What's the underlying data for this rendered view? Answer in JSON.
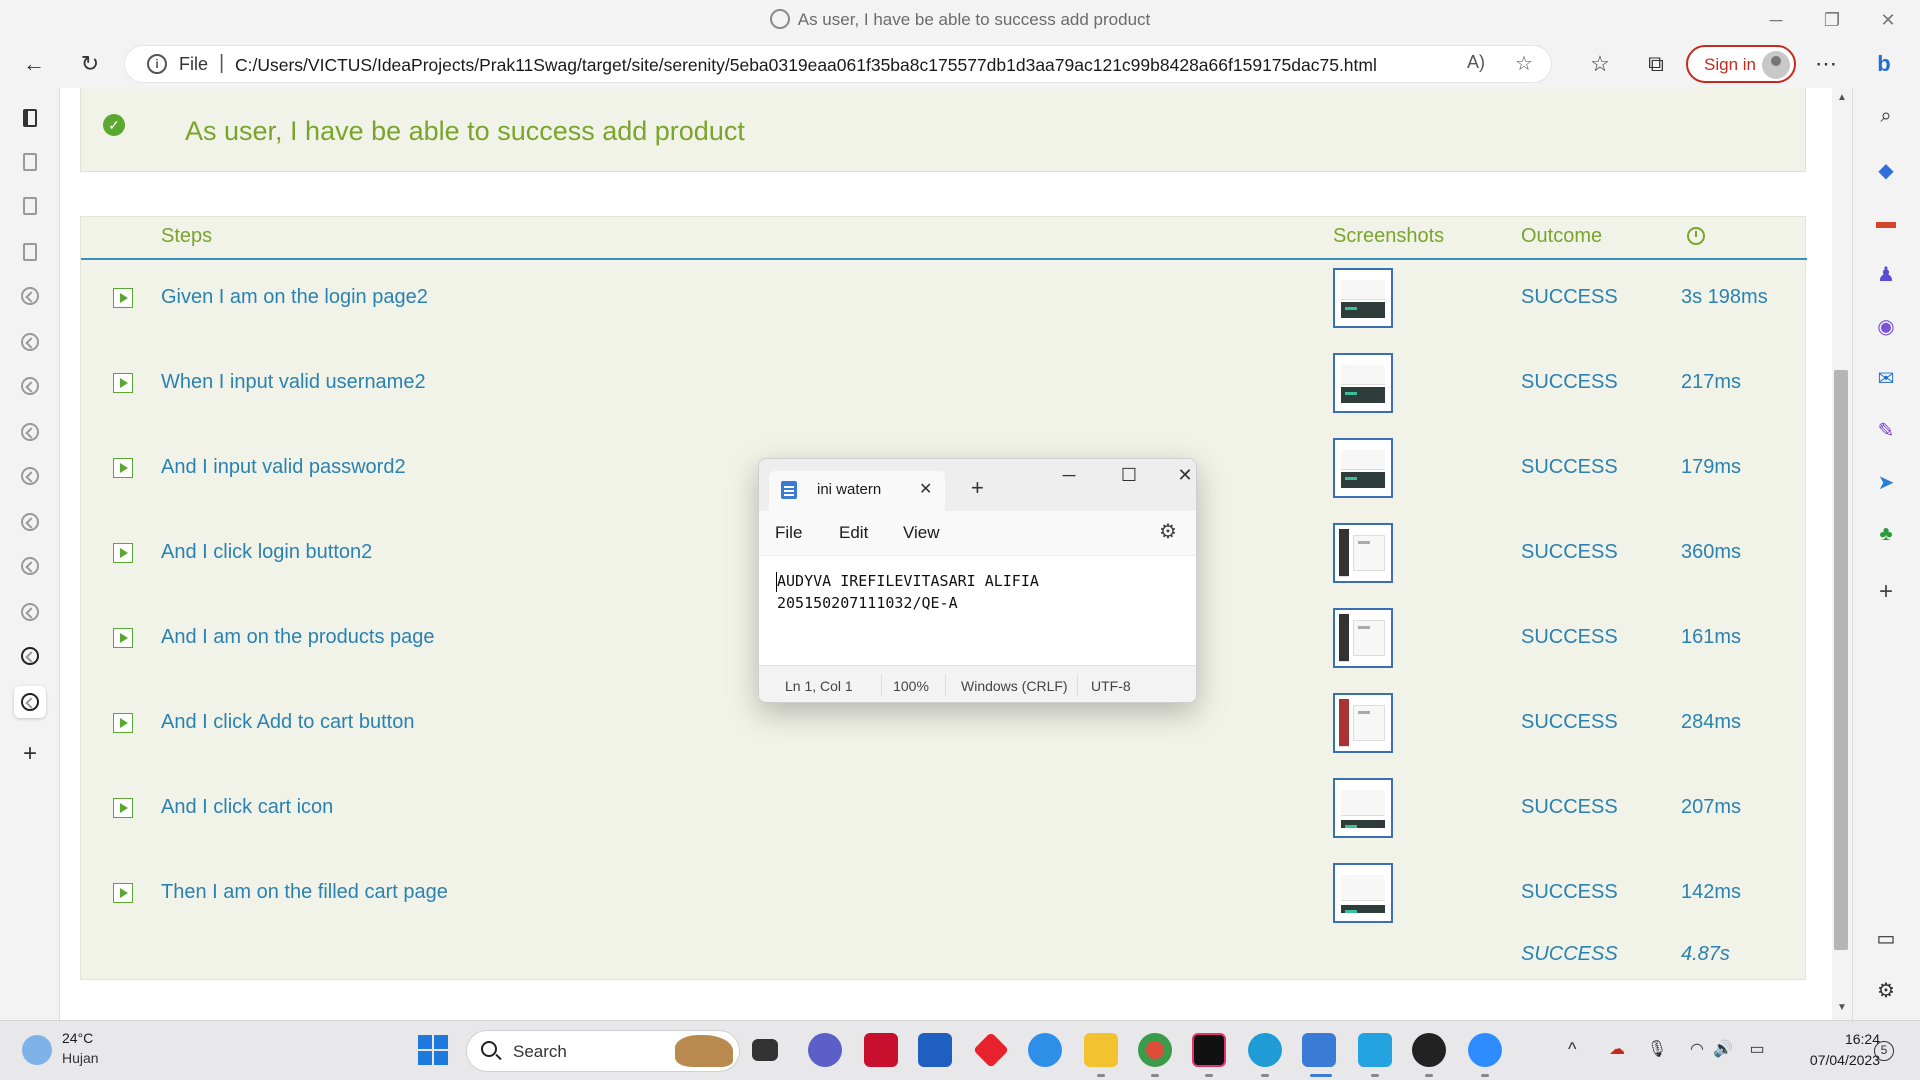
{
  "window": {
    "title": "As user, I have be able to success add product"
  },
  "address": {
    "scheme_label": "File",
    "url": "C:/Users/VICTUS/IdeaProjects/Prak11Swag/target/site/serenity/5eba0319eaa061f35ba8c175577db1d3aa79ac121c99b8428a66f159175dac75.html"
  },
  "signin": {
    "label": "Sign in"
  },
  "scenario": {
    "title": "As user, I have be able to success add product"
  },
  "table": {
    "headers": {
      "steps": "Steps",
      "screenshots": "Screenshots",
      "outcome": "Outcome"
    },
    "rows": [
      {
        "step": "Given I am on the login page2",
        "outcome": "SUCCESS",
        "duration": "3s 198ms"
      },
      {
        "step": "When I input valid username2",
        "outcome": "SUCCESS",
        "duration": "217ms"
      },
      {
        "step": "And I input valid password2",
        "outcome": "SUCCESS",
        "duration": "179ms"
      },
      {
        "step": "And I click login button2",
        "outcome": "SUCCESS",
        "duration": "360ms"
      },
      {
        "step": "And I am on the products page",
        "outcome": "SUCCESS",
        "duration": "161ms"
      },
      {
        "step": "And I click Add to cart button",
        "outcome": "SUCCESS",
        "duration": "284ms"
      },
      {
        "step": "And I click cart icon",
        "outcome": "SUCCESS",
        "duration": "207ms"
      },
      {
        "step": "Then I am on the filled cart page",
        "outcome": "SUCCESS",
        "duration": "142ms"
      }
    ],
    "total": {
      "outcome": "SUCCESS",
      "duration": "4.87s"
    }
  },
  "notepad": {
    "tab_title": "ini watern",
    "menu": {
      "file": "File",
      "edit": "Edit",
      "view": "View"
    },
    "content": [
      "AUDYVA IREFILEVITASARI ALIFIA",
      "205150207111032/QE-A"
    ],
    "status": {
      "position": "Ln 1, Col 1",
      "zoom": "100%",
      "line_ending": "Windows (CRLF)",
      "encoding": "UTF-8"
    }
  },
  "taskbar": {
    "weather_temp": "24°C",
    "weather_desc": "Hujan",
    "search_label": "Search",
    "time": "16:24",
    "date": "07/04/2023",
    "notifications": "5"
  },
  "colors": {
    "success": "#2a82b2",
    "accent_green": "#7aa42c",
    "signin_red": "#c42b1c"
  }
}
